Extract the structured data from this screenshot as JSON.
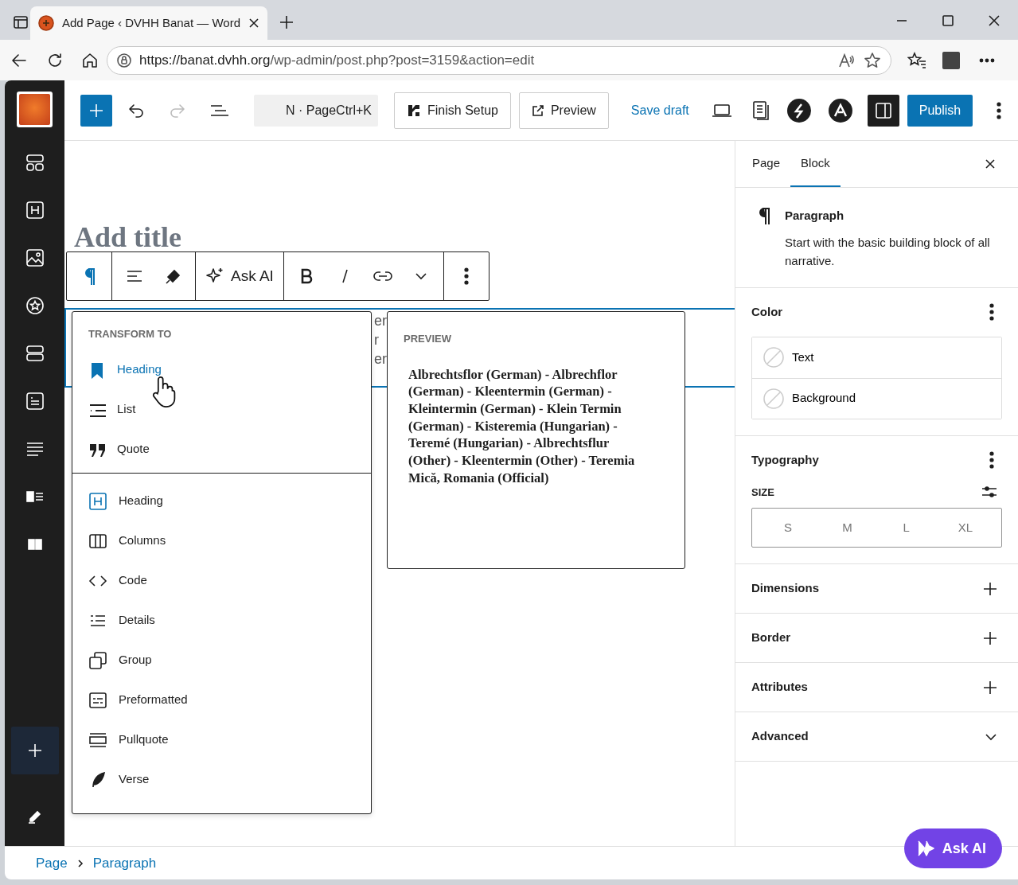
{
  "browser": {
    "tab_title": "Add Page ‹ DVHH Banat — Word",
    "url_host": "https://banat.dvhh.org",
    "url_path": "/wp-admin/post.php?post=3159&action=edit"
  },
  "toolbar": {
    "command_hint": "N · PageCtrl+K",
    "finish_setup": "Finish Setup",
    "preview": "Preview",
    "save_draft": "Save draft",
    "publish": "Publish",
    "redo_disabled": true
  },
  "editor": {
    "title_placeholder": "Add title",
    "fragments_right": [
      "er",
      "r",
      "er"
    ]
  },
  "block_toolbar": {
    "ask_ai": "Ask AI"
  },
  "transform_menu": {
    "heading": "TRANSFORM TO",
    "suggested": [
      {
        "label": "Heading",
        "selected": true
      },
      {
        "label": "List",
        "selected": false
      },
      {
        "label": "Quote",
        "selected": false
      }
    ],
    "items": [
      "Heading",
      "Columns",
      "Code",
      "Details",
      "Group",
      "Preformatted",
      "Pullquote",
      "Verse"
    ]
  },
  "preview": {
    "heading": "PREVIEW",
    "text": "Albrechtsflor (German) - Albrechflor (German) - Kleentermin (German) - Kleintermin (German) - Klein Termin (German) - Kisteremia (Hungarian) - Teremé (Hungarian) - Albrechtsflur (Other) - Kleentermin (Other) - Teremia Mică, Romania (Official)"
  },
  "sidebar": {
    "tabs": [
      {
        "label": "Page",
        "selected": false
      },
      {
        "label": "Block",
        "selected": true
      }
    ],
    "block_name": "Paragraph",
    "block_description": "Start with the basic building block of all narrative.",
    "panels": [
      {
        "kind": "color",
        "title": "Color",
        "options": [
          "Text",
          "Background"
        ]
      },
      {
        "kind": "typography",
        "title": "Typography",
        "size_label": "SIZE",
        "sizes": [
          {
            "label": "S",
            "selected": false
          },
          {
            "label": "M",
            "selected": false
          },
          {
            "label": "L",
            "selected": false
          },
          {
            "label": "XL",
            "selected": false
          }
        ]
      },
      {
        "kind": "tool",
        "title": "Dimensions"
      },
      {
        "kind": "tool",
        "title": "Border"
      },
      {
        "kind": "tool",
        "title": "Attributes"
      },
      {
        "kind": "collapsible",
        "title": "Advanced",
        "expanded": false
      }
    ]
  },
  "breadcrumb": [
    "Page",
    "Paragraph"
  ],
  "ask_ai_button": "Ask AI"
}
